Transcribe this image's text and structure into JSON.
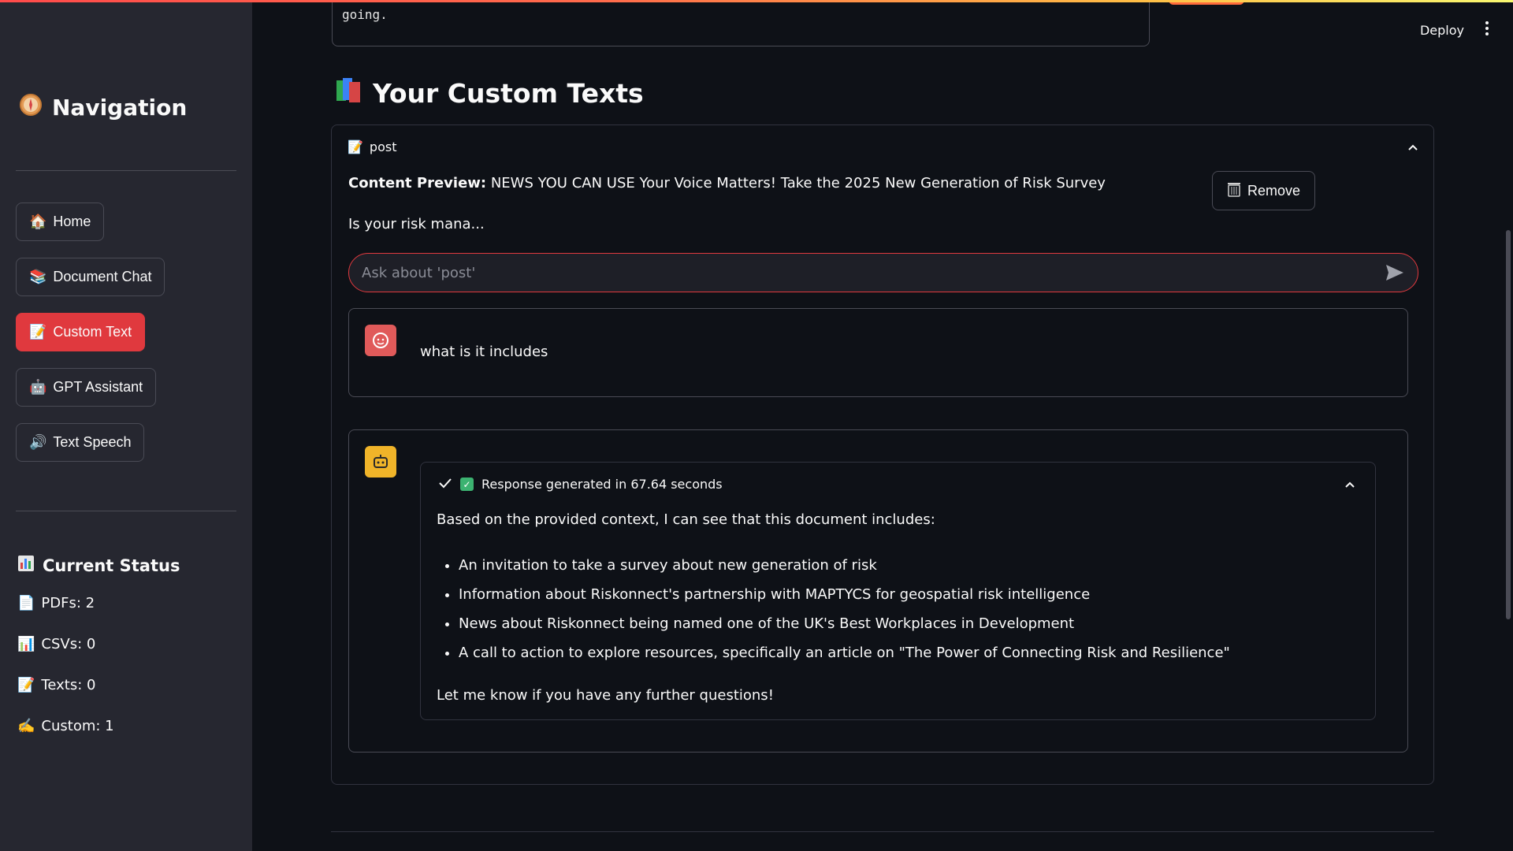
{
  "sidebar": {
    "title": "Navigation",
    "title_icon": "compass-icon",
    "nav": [
      {
        "label": "Home",
        "icon": "🏠"
      },
      {
        "label": "Document Chat",
        "icon": "📚"
      },
      {
        "label": "Custom Text",
        "icon": "📝"
      },
      {
        "label": "GPT Assistant",
        "icon": "🤖"
      },
      {
        "label": "Text Speech",
        "icon": "🔊"
      }
    ],
    "active_nav": "Custom Text",
    "status_title": "Current Status",
    "status": [
      {
        "label": "PDFs: 2",
        "icon": "📄"
      },
      {
        "label": "CSVs: 0",
        "icon": "📊"
      },
      {
        "label": "Texts: 0",
        "icon": "📝"
      },
      {
        "label": "Custom: 1",
        "icon": "✍️"
      }
    ]
  },
  "header": {
    "deploy_label": "Deploy",
    "prev_text": "going."
  },
  "main": {
    "section_title": "Your Custom Texts",
    "expander": {
      "label": "post",
      "preview_label": "Content Preview:",
      "preview_text": "NEWS YOU CAN USE Your Voice Matters! Take the 2025 New Generation of Risk Survey",
      "preview_text2": "Is your risk mana...",
      "remove_label": "Remove",
      "ask_placeholder": "Ask about 'post'"
    },
    "user_message": "what is it includes",
    "response": {
      "status": "Response generated in 67.64 seconds",
      "intro": "Based on the provided context, I can see that this document includes:",
      "items": [
        "An invitation to take a survey about new generation of risk",
        "Information about Riskonnect's partnership with MAPTYCS for geospatial risk intelligence",
        "News about Riskonnect being named one of the UK's Best Workplaces in Development",
        "A call to action to explore resources, specifically an article on \"The Power of Connecting Risk and Resilience\""
      ],
      "outro": "Let me know if you have any further questions!"
    }
  },
  "colors": {
    "accent": "#e0393e",
    "background": "#0e1117",
    "sidebar": "#262730"
  }
}
